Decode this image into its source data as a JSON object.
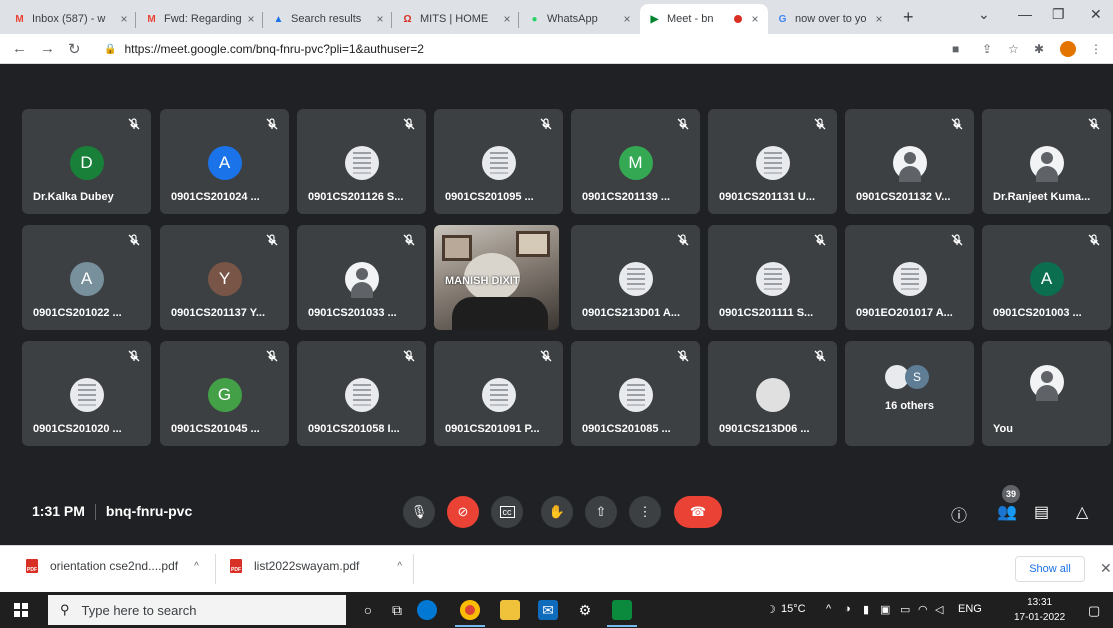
{
  "browser": {
    "tabs": [
      {
        "title": "Inbox (587) - w",
        "favicon": "gmail-icon"
      },
      {
        "title": "Fwd: Regarding",
        "favicon": "gmail-icon"
      },
      {
        "title": "Search results",
        "favicon": "drive-icon"
      },
      {
        "title": "MITS | HOME",
        "favicon": "mits-icon"
      },
      {
        "title": "WhatsApp",
        "favicon": "whatsapp-icon"
      },
      {
        "title": "Meet - bn",
        "favicon": "meet-icon",
        "active": true
      },
      {
        "title": "now over to yo",
        "favicon": "google-icon"
      }
    ],
    "new_tab": "+",
    "close": "×",
    "url": "https://meet.google.com/bnq-fnru-pvc?pli=1&authuser=2"
  },
  "meet": {
    "participants": [
      {
        "name": "Dr.Kalka Dubey",
        "avatar": "D",
        "color": "#188038"
      },
      {
        "name": "0901CS201024 ...",
        "avatar": "A",
        "color": "#1a73e8"
      },
      {
        "name": "0901CS201126 S...",
        "avatar": "",
        "kind": "doc"
      },
      {
        "name": "0901CS201095 ...",
        "avatar": "",
        "kind": "doc"
      },
      {
        "name": "0901CS201139 ...",
        "avatar": "M",
        "color": "#34a853"
      },
      {
        "name": "0901CS201131 U...",
        "avatar": "",
        "kind": "doc"
      },
      {
        "name": "0901CS201132 V...",
        "avatar": "",
        "kind": "photo"
      },
      {
        "name": "Dr.Ranjeet Kuma...",
        "avatar": "",
        "kind": "photo"
      },
      {
        "name": "0901CS201022 ...",
        "avatar": "A",
        "color": "#78909c"
      },
      {
        "name": "0901CS201137 Y...",
        "avatar": "Y",
        "color": "#795548"
      },
      {
        "name": "0901CS201033 ...",
        "avatar": "",
        "kind": "photo"
      },
      {
        "name": "0901CS213D01 A...",
        "avatar": "",
        "kind": "doc"
      },
      {
        "name": "0901CS201111 S...",
        "avatar": "",
        "kind": "doc"
      },
      {
        "name": "0901EO201017 A...",
        "avatar": "",
        "kind": "doc"
      },
      {
        "name": "0901CS201003 ...",
        "avatar": "A",
        "color": "#0b6e4f"
      },
      {
        "name": "0901CS201020 ...",
        "avatar": "",
        "kind": "doc"
      },
      {
        "name": "0901CS201045 ...",
        "avatar": "G",
        "color": "#43a047"
      },
      {
        "name": "0901CS201058 I...",
        "avatar": "",
        "kind": "doc"
      },
      {
        "name": "0901CS201091 P...",
        "avatar": "",
        "kind": "doc"
      },
      {
        "name": "0901CS201085 ...",
        "avatar": "",
        "kind": "doc"
      },
      {
        "name": "0901CS213D06 ...",
        "avatar": "",
        "kind": "blank"
      }
    ],
    "video_participant": {
      "name": "MANISH DIXIT"
    },
    "others": {
      "label": "16 others",
      "avatar": "S"
    },
    "self": {
      "name": "You"
    },
    "time": "1:31 PM",
    "meeting_code": "bnq-fnru-pvc",
    "participant_count": "39"
  },
  "downloads": {
    "files": [
      {
        "name": "orientation cse2nd....pdf",
        "type": "PDF"
      },
      {
        "name": "list2022swayam.pdf",
        "type": "PDF"
      }
    ],
    "show_all": "Show all"
  },
  "taskbar": {
    "search_placeholder": "Type here to search",
    "weather": "15°C",
    "language": "ENG",
    "time": "13:31",
    "date": "17-01-2022"
  }
}
